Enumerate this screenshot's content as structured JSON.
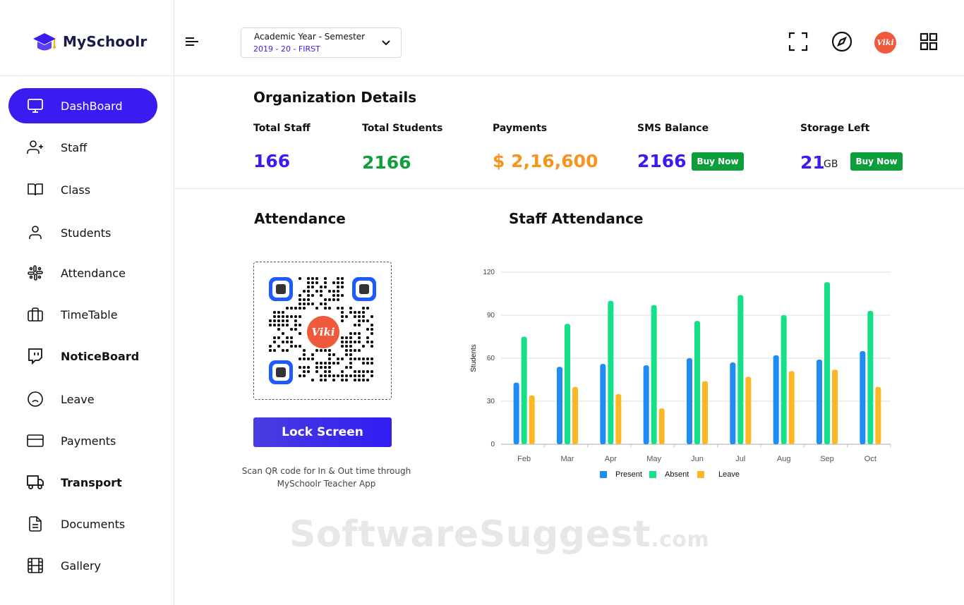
{
  "brand": {
    "name": "MySchoolr",
    "logo_icon": "graduation-cap-icon",
    "accent": "#3a1cf0"
  },
  "sidebar": {
    "items": [
      {
        "label": "DashBoard",
        "icon": "monitor-icon",
        "active": true
      },
      {
        "label": "Staff",
        "icon": "user-plus-icon"
      },
      {
        "label": "Class",
        "icon": "book-icon"
      },
      {
        "label": "Students",
        "icon": "user-icon"
      },
      {
        "label": "Attendance",
        "icon": "slack-icon"
      },
      {
        "label": "TimeTable",
        "icon": "briefcase-icon"
      },
      {
        "label": "NoticeBoard",
        "icon": "message-icon"
      },
      {
        "label": "Leave",
        "icon": "frown-icon"
      },
      {
        "label": "Payments",
        "icon": "credit-card-icon"
      },
      {
        "label": "Transport",
        "icon": "truck-icon"
      },
      {
        "label": "Documents",
        "icon": "document-icon"
      },
      {
        "label": "Gallery",
        "icon": "film-icon"
      }
    ]
  },
  "header": {
    "year_label": "Academic Year - Semester",
    "year_value": "2019 - 20 - FIRST",
    "avatar_text": "Viki",
    "icons": [
      "menu-icon",
      "fullscreen-icon",
      "compass-icon",
      "avatar",
      "grid-icon"
    ]
  },
  "org": {
    "title": "Organization Details",
    "stats": [
      {
        "label": "Total Staff",
        "value": "166",
        "color": "#3a1cf0"
      },
      {
        "label": "Total Students",
        "value": "2166",
        "color": "#0e9f3c"
      },
      {
        "label": "Payments",
        "value": "$ 2,16,600",
        "color": "#f7931e"
      },
      {
        "label": "SMS Balance",
        "value": "2166",
        "color": "#3a1cf0",
        "button": "Buy Now"
      },
      {
        "label": "Storage Left",
        "value": "21",
        "unit": "GB",
        "color": "#3a1cf0",
        "button": "Buy Now"
      }
    ]
  },
  "attendance": {
    "title": "Attendance",
    "qr_logo_text": "Viki",
    "lock_button": "Lock Screen",
    "caption_line1": "Scan QR code for In & Out time through",
    "caption_line2": "MySchoolr Teacher App"
  },
  "staff_attendance": {
    "title": "Staff Attendance"
  },
  "chart_data": {
    "type": "bar",
    "title": "",
    "xlabel": "",
    "ylabel": "Students",
    "ylim": [
      0,
      120
    ],
    "yticks": [
      0,
      30,
      60,
      90,
      120
    ],
    "grid": true,
    "legend": "bottom",
    "categories": [
      "Feb",
      "Mar",
      "Apr",
      "May",
      "Jun",
      "Jul",
      "Aug",
      "Sep",
      "Oct"
    ],
    "series": [
      {
        "name": "Present",
        "color": "#1e8cf0",
        "values": [
          43,
          54,
          56,
          55,
          60,
          57,
          62,
          59,
          65
        ]
      },
      {
        "name": "Absent",
        "color": "#15e08a",
        "values": [
          75,
          84,
          100,
          97,
          86,
          104,
          90,
          113,
          93
        ]
      },
      {
        "name": "Leave",
        "color": "#fdb726",
        "values": [
          34,
          40,
          35,
          25,
          44,
          47,
          51,
          52,
          40
        ]
      }
    ]
  },
  "watermark": {
    "main": "SoftwareSuggest",
    "suffix": ".com"
  }
}
